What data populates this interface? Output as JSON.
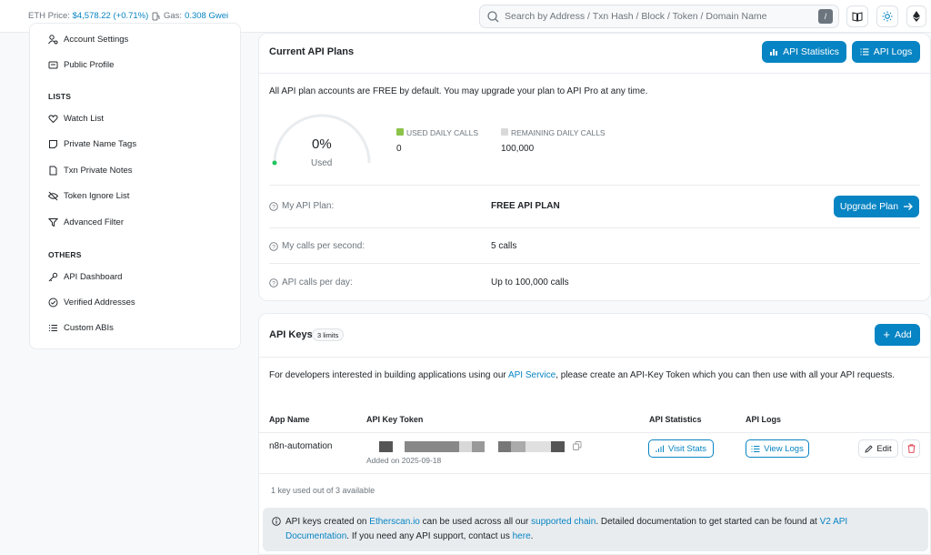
{
  "topbar": {
    "eth_price_label": "ETH Price:",
    "eth_price_value": "$4,578.22 (+0.71%)",
    "gas_label": "Gas:",
    "gas_value": "0.308 Gwei",
    "search_placeholder": "Search by Address / Txn Hash / Block / Token / Domain Name",
    "search_shortcut": "/"
  },
  "sidebar": {
    "items_top": [
      {
        "label": "Account Settings",
        "icon": "user-gear-icon"
      },
      {
        "label": "Public Profile",
        "icon": "id-card-icon"
      }
    ],
    "lists_heading": "LISTS",
    "lists": [
      {
        "label": "Watch List",
        "icon": "heart-icon"
      },
      {
        "label": "Private Name Tags",
        "icon": "sticky-note-icon"
      },
      {
        "label": "Txn Private Notes",
        "icon": "file-icon"
      },
      {
        "label": "Token Ignore List",
        "icon": "eye-slash-icon"
      },
      {
        "label": "Advanced Filter",
        "icon": "filter-icon"
      }
    ],
    "others_heading": "OTHERS",
    "others": [
      {
        "label": "API Dashboard",
        "icon": "key-icon"
      },
      {
        "label": "Verified Addresses",
        "icon": "check-circle-icon"
      },
      {
        "label": "Custom ABIs",
        "icon": "list-icon"
      }
    ]
  },
  "plans": {
    "title": "Current API Plans",
    "stats_button": "API Statistics",
    "logs_button": "API Logs",
    "intro": "All API plan accounts are FREE by default. You may upgrade your plan to API Pro at any time.",
    "gauge_percent": "0%",
    "gauge_label": "Used",
    "used_fraction": 0,
    "used_daily_label": "USED DAILY CALLS",
    "used_daily_value": "0",
    "remaining_daily_label": "REMAINING DAILY CALLS",
    "remaining_daily_value": "100,000",
    "rows": [
      {
        "label": "My API Plan:",
        "value": "FREE API PLAN"
      },
      {
        "label": "My calls per second:",
        "value": "5 calls"
      },
      {
        "label": "API calls per day:",
        "value": "Up to 100,000 calls"
      }
    ],
    "upgrade_button": "Upgrade Plan",
    "colors": {
      "accent": "#0784c3",
      "used": "#8bc34a",
      "remaining": "#d9d9d9"
    }
  },
  "keys": {
    "title": "API Keys",
    "limit_badge": "3 limits",
    "add_button": "Add",
    "desc_before": "For developers interested in building applications using our ",
    "desc_link": "API Service",
    "desc_after": ", please create an API-Key Token which you can then use with all your API requests.",
    "headers": [
      "App Name",
      "API Key Token",
      "API Statistics",
      "API Logs"
    ],
    "row": {
      "app_name": "n8n-automation",
      "added": "Added on 2025-09-18",
      "stats_button": "Visit Stats",
      "logs_button": "View Logs",
      "edit_button": "Edit"
    },
    "footer": "1 key used out of 3 available",
    "notice": {
      "t1": "API keys created on ",
      "link1": "Etherscan.io",
      "t2": " can be used across all our ",
      "link2": "supported chain",
      "t3": ". Detailed documentation to get started can be found at ",
      "link3": "V2 API Documentation",
      "t4": ". If you need any API support, contact us ",
      "link4": "here",
      "t5": "."
    }
  }
}
